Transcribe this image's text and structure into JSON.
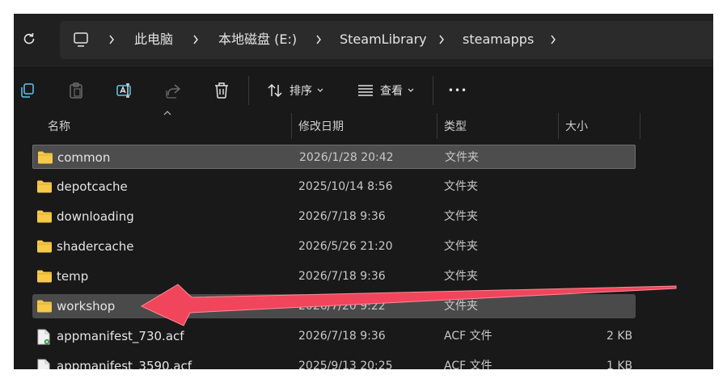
{
  "nav": {
    "breadcrumbs": [
      "此电脑",
      "本地磁盘 (E:)",
      "SteamLibrary",
      "steamapps"
    ]
  },
  "toolbar": {
    "sort_label": "排序",
    "view_label": "查看",
    "more_label": "•••"
  },
  "columns": [
    "名称",
    "修改日期",
    "类型",
    "大小"
  ],
  "files": [
    {
      "name": "common",
      "date": "2026/1/28 20:42",
      "type": "文件夹",
      "size": "",
      "icon": "folder-icon",
      "state": "selected"
    },
    {
      "name": "depotcache",
      "date": "2025/10/14 8:56",
      "type": "文件夹",
      "size": "",
      "icon": "folder-icon",
      "state": ""
    },
    {
      "name": "downloading",
      "date": "2026/7/18 9:36",
      "type": "文件夹",
      "size": "",
      "icon": "folder-icon",
      "state": ""
    },
    {
      "name": "shadercache",
      "date": "2026/5/26 21:20",
      "type": "文件夹",
      "size": "",
      "icon": "folder-icon",
      "state": ""
    },
    {
      "name": "temp",
      "date": "2026/7/18 9:36",
      "type": "文件夹",
      "size": "",
      "icon": "folder-icon",
      "state": ""
    },
    {
      "name": "workshop",
      "date": "2026/7/20 9:22",
      "type": "文件夹",
      "size": "",
      "icon": "folder-icon",
      "state": "hover"
    },
    {
      "name": "appmanifest_730.acf",
      "date": "2026/7/18 9:36",
      "type": "ACF 文件",
      "size": "2 KB",
      "icon": "file-icon",
      "state": ""
    },
    {
      "name": "appmanifest_3590.acf",
      "date": "2025/9/13 20:25",
      "type": "ACF 文件",
      "size": "1 KB",
      "icon": "file-icon",
      "state": ""
    }
  ],
  "colors": {
    "window_bg": "#191919",
    "address_bg": "#2b2b2b",
    "folder_yellow": "#f7c948",
    "arrow_red": "#f0455b"
  }
}
